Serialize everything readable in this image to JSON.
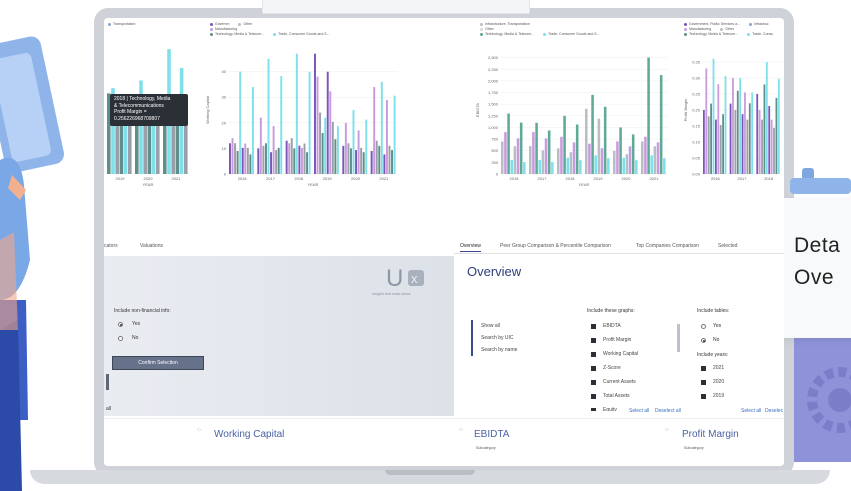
{
  "legends": {
    "c1": [
      {
        "label": "Transportation",
        "color": "#8aa6c9"
      }
    ],
    "c2": [
      {
        "label": "Governm",
        "color": "#7b56b8"
      },
      {
        "label": "Manufacturing",
        "color": "#c99bdc"
      },
      {
        "label": "Other",
        "color": "#b9bec5"
      },
      {
        "label": "Technology, Media & Telecom...",
        "color": "#5f8f8a"
      },
      {
        "label": "Trade, Consumer Goods and S...",
        "color": "#7fe0ec"
      }
    ],
    "c3": [
      {
        "label": "Infrastructure, Transportation",
        "color": "#b9bec5"
      },
      {
        "label": "Other",
        "color": "#d9d9d9"
      },
      {
        "label": "Technology, Media & Telecom...",
        "color": "#5faa96"
      },
      {
        "label": "Trade, Consumer Goods and S...",
        "color": "#7fe0ec"
      }
    ],
    "c4": [
      {
        "label": "Government, Public Services a...",
        "color": "#7b56b8"
      },
      {
        "label": "Infrastruc",
        "color": "#8aa6c9"
      },
      {
        "label": "Manufacturing",
        "color": "#c99bdc"
      },
      {
        "label": "Other",
        "color": "#b9bec5"
      },
      {
        "label": "Technology, Media & Telecom...",
        "color": "#5f8f8a"
      },
      {
        "label": "Trade, Consu",
        "color": "#7fe0ec"
      }
    ]
  },
  "chart_data": [
    {
      "type": "bar",
      "x": [
        "2019",
        "2020",
        "2021"
      ],
      "xlabel": "YEAR",
      "ylabel": "",
      "series": [
        {
          "name": "Technology, Media & Telecommunications",
          "values": [
            0.31,
            0.3,
            0.25
          ]
        },
        {
          "name": "Trade, Consumer Goods and S...",
          "values": [
            0.33,
            0.36,
            0.48
          ]
        },
        {
          "name": "Other",
          "values": [
            0.3,
            0.27,
            0.29
          ]
        }
      ]
    },
    {
      "type": "bar",
      "x": [
        "2016",
        "2017",
        "2018",
        "2019",
        "2020",
        "2021"
      ],
      "xlabel": "YEAR",
      "ylabel": "Working Capital",
      "ylim": [
        0,
        50
      ],
      "yticks": [
        "0",
        "10",
        "20",
        "30",
        "40"
      ],
      "series": [
        {
          "name": "Government",
          "values": [
            12,
            10,
            13,
            47,
            11,
            9
          ]
        },
        {
          "name": "Manufacturing",
          "values": [
            14,
            22,
            12,
            38,
            20,
            34
          ]
        },
        {
          "name": "Other",
          "values": [
            12,
            11,
            14,
            24,
            12,
            13
          ]
        },
        {
          "name": "Technology, Media & Telecom...",
          "values": [
            9,
            12,
            10,
            16,
            10,
            11
          ]
        },
        {
          "name": "Trade, Consumer Goods and S...",
          "values": [
            40,
            45,
            47,
            22,
            25,
            36
          ]
        }
      ]
    },
    {
      "type": "bar",
      "x": [
        "2016",
        "2017",
        "2018",
        "2019",
        "2020",
        "2021"
      ],
      "xlabel": "YEAR",
      "ylabel": "EBIDTA",
      "ylim": [
        0,
        2750
      ],
      "yticks": [
        "0",
        "250",
        "500",
        "750",
        "1,000",
        "1,250",
        "1,500",
        "1,750",
        "2,000",
        "2,250",
        "2,500"
      ],
      "series": [
        {
          "name": "Infrastructure, Transportation",
          "values": [
            700,
            600,
            550,
            1400,
            500,
            700
          ]
        },
        {
          "name": "Other",
          "values": [
            900,
            900,
            800,
            650,
            700,
            800
          ]
        },
        {
          "name": "Technology, Media & Telecom...",
          "values": [
            1300,
            1100,
            1250,
            1700,
            1000,
            2500
          ]
        },
        {
          "name": "Trade, Consumer Goods and S...",
          "values": [
            300,
            300,
            350,
            400,
            350,
            400
          ]
        }
      ]
    },
    {
      "type": "bar",
      "x": [
        "2016",
        "2017",
        "2018"
      ],
      "xlabel": "",
      "ylabel": "Profit Margin",
      "ylim": [
        0,
        0.4
      ],
      "yticks": [
        "0.00",
        "0.05",
        "0.10",
        "0.15",
        "0.20",
        "0.25",
        "0.30",
        "0.35"
      ],
      "series": [
        {
          "name": "Government",
          "values": [
            0.2,
            0.22,
            0.25
          ]
        },
        {
          "name": "Manufacturing",
          "values": [
            0.33,
            0.3,
            0.2
          ]
        },
        {
          "name": "Other",
          "values": [
            0.18,
            0.2,
            0.17
          ]
        },
        {
          "name": "Technology",
          "values": [
            0.22,
            0.26,
            0.28
          ]
        },
        {
          "name": "Trade",
          "values": [
            0.36,
            0.3,
            0.35
          ]
        }
      ]
    }
  ],
  "tooltip": {
    "line1": "2018 | Technology, Media",
    "line2": "& Telecommunications",
    "line3": "Profit Margin =",
    "line4": "0.256226968709807"
  },
  "tabs_left": {
    "a": "cators",
    "b": "Valuations"
  },
  "tabs_right": {
    "overview": "Overview",
    "peer": "Peer Group Comparison & Percentile Comparison",
    "top": "Top Companies Comparison",
    "sel": "Selected"
  },
  "left_panel": {
    "logo_tagline": "Insights that make sense",
    "nonfin_label": "Include non-financial info:",
    "yes": "Yes",
    "no": "No",
    "confirm": "Confirm Selection",
    "all": "all"
  },
  "overview": {
    "title": "Overview",
    "nav": [
      "Show all",
      "Search by UIC",
      "Search by name"
    ],
    "graphs_label": "Include these graphs:",
    "graphs": [
      "EBIDTA",
      "Profit Margin",
      "Working Capital",
      "Z-Score",
      "Current Assets",
      "Total Assets",
      "Equity"
    ],
    "select_all": "Select all",
    "deselect_all": "Deselect all",
    "tables_label": "Include tables:",
    "tables_yes": "Yes",
    "tables_no": "No",
    "years_label": "Include years:",
    "years": [
      "2021",
      "2020",
      "2019"
    ],
    "years_select_all": "Select all",
    "years_deselect": "Deselec"
  },
  "bottom": {
    "working_capital": "Working Capital",
    "ebidta": "EBIDTA",
    "profit_margin": "Profit Margin",
    "subcat": "Subcategory"
  },
  "card": {
    "line1": "Deta",
    "line2": "Ove"
  }
}
